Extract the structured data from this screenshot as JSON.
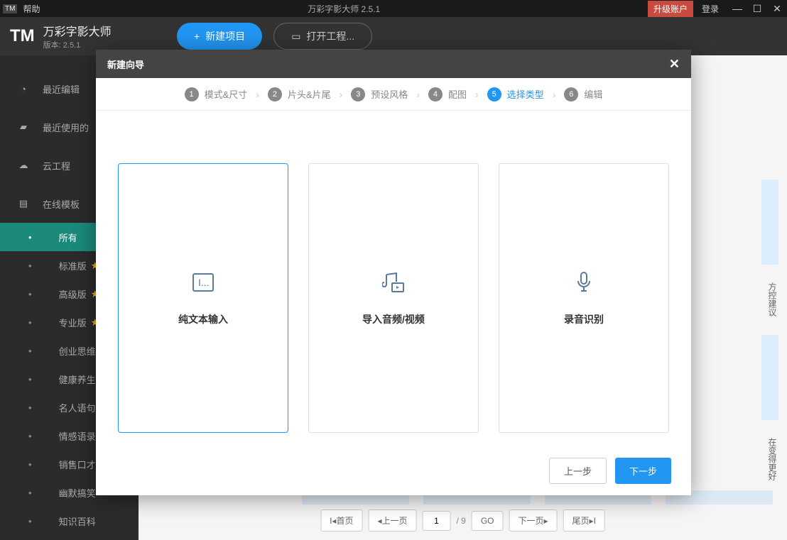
{
  "titlebar": {
    "help": "帮助",
    "title": "万彩字影大师 2.5.1",
    "upgrade": "升级账户",
    "login": "登录"
  },
  "header": {
    "logo_tm": "TM",
    "app_name": "万彩字影大师",
    "version": "版本: 2.5.1",
    "new_project": "新建项目",
    "open_project": "打开工程..."
  },
  "sidebar": {
    "recent_edit": "最近编辑",
    "recent_use": "最近使用的",
    "cloud_project": "云工程",
    "online_template": "在线模板",
    "items": [
      {
        "label": "所有"
      },
      {
        "label": "标准版"
      },
      {
        "label": "高级版"
      },
      {
        "label": "专业版"
      },
      {
        "label": "创业思维"
      },
      {
        "label": "健康养生"
      },
      {
        "label": "名人语句"
      },
      {
        "label": "情感语录"
      },
      {
        "label": "销售口才"
      },
      {
        "label": "幽默搞笑"
      },
      {
        "label": "知识百科"
      }
    ]
  },
  "content": {
    "hint1": "方控建议",
    "hint2": "在变得更好"
  },
  "pagination": {
    "first": "I◂首页",
    "prev": "◂上一页",
    "current": "1",
    "total": "/ 9",
    "go": "GO",
    "next": "下一页▸",
    "last": "尾页▸I"
  },
  "modal": {
    "title": "新建向导",
    "steps": [
      {
        "num": "1",
        "label": "模式&尺寸"
      },
      {
        "num": "2",
        "label": "片头&片尾"
      },
      {
        "num": "3",
        "label": "预设风格"
      },
      {
        "num": "4",
        "label": "配图"
      },
      {
        "num": "5",
        "label": "选择类型"
      },
      {
        "num": "6",
        "label": "编辑"
      }
    ],
    "types": [
      {
        "label": "纯文本输入"
      },
      {
        "label": "导入音频/视频"
      },
      {
        "label": "录音识别"
      }
    ],
    "prev": "上一步",
    "next": "下一步"
  }
}
